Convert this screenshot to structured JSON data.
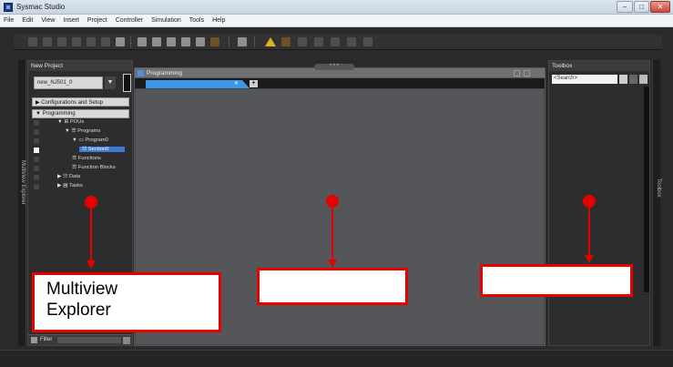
{
  "window": {
    "title": "Sysmac Studio",
    "controls": {
      "minimize": "–",
      "maximize": "□",
      "close": "✕"
    }
  },
  "menu": [
    "File",
    "Edit",
    "View",
    "Insert",
    "Project",
    "Controller",
    "Simulation",
    "Tools",
    "Help"
  ],
  "toolbar": {
    "icons": [
      "cut-icon",
      "copy-icon",
      "paste-icon",
      "delete-icon",
      "undo-icon",
      "redo-icon",
      "save-icon",
      "cross-reference-icon",
      "build-icon",
      "find-icon",
      "replace-icon",
      "search-icon",
      "stop-icon",
      "online-icon",
      "warning-icon",
      "transfer-icon",
      "compare-icon",
      "simulate-icon"
    ]
  },
  "multiview": {
    "side_label": "Multiview Explorer",
    "title": "New Project",
    "device": "new_NJ501_0",
    "device_caret": "▼",
    "sections": [
      "▶ Configurations and Setup",
      "▼ Programming"
    ],
    "tree": [
      {
        "label": "▼ ⊞ POUs",
        "selected": false
      },
      {
        "label": "▼ ☰ Programs",
        "selected": false
      },
      {
        "label": "▼ ▭ Program0",
        "selected": false
      },
      {
        "label": "☷ Section0",
        "selected": true
      },
      {
        "label": "☰ Functions",
        "selected": false
      },
      {
        "label": "☰ Function Blocks",
        "selected": false
      },
      {
        "label": "▶ ☷ Data",
        "selected": false
      },
      {
        "label": "▶ ▤ Tasks",
        "selected": false
      }
    ],
    "filter_label": "Filter"
  },
  "edit_pane": {
    "title": "Programming",
    "grip": "• • •",
    "tab_close": "✕",
    "add_tab": "+"
  },
  "toolbox": {
    "side_label": "Toolbox",
    "title": "Toolbox",
    "search_placeholder": "<Search>"
  },
  "annotations": {
    "color": "#e60000",
    "callouts": [
      {
        "target": "multiview",
        "text": "Multiview\nExplorer"
      },
      {
        "target": "edit_pane",
        "text": ""
      },
      {
        "target": "toolbox",
        "text": ""
      }
    ]
  }
}
